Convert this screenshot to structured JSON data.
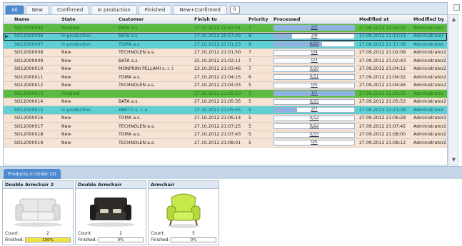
{
  "tabs": [
    {
      "label": "All",
      "active": true
    },
    {
      "label": "New",
      "active": false
    },
    {
      "label": "Confirmed",
      "active": false
    },
    {
      "label": "In production",
      "active": false
    },
    {
      "label": "Finished",
      "active": false
    },
    {
      "label": "New+Confirmed",
      "active": false
    }
  ],
  "tab_count": "0",
  "columns": {
    "name": "Name",
    "state": "State",
    "customer": "Customer",
    "finish_to": "Finish to",
    "priority": "Priority",
    "processed": "Processed",
    "modified_at": "Modified at",
    "modified_by": "Modified by"
  },
  "rows": [
    {
      "name": "SO12000005",
      "state": "Finished",
      "customer": "BATA a.s.",
      "finish_to": "27.10.2012 20:52:01",
      "priority": "7",
      "processed": "2/2",
      "progress": 1.0,
      "modified_at": "27.09.2012 21:15:34",
      "modified_by": "Administrator",
      "kind": "fin",
      "selected": false
    },
    {
      "name": "SO12000006",
      "state": "In production",
      "customer": "BATA a.s.",
      "finish_to": "27.10.2012 20:57:29",
      "priority": "8",
      "processed": "2/9",
      "progress": 0.22,
      "modified_at": "27.09.2012 21:13:19",
      "modified_by": "Administrator",
      "kind": "prod",
      "selected": true
    },
    {
      "name": "SO12000007",
      "state": "In production",
      "customer": "TOMA a.s.",
      "finish_to": "27.10.2012 21:01:23",
      "priority": "8",
      "processed": "6/10",
      "progress": 0.6,
      "modified_at": "27.09.2012 21:17:38",
      "modified_by": "Administrator",
      "kind": "prod",
      "selected": false
    },
    {
      "name": "SO12000008",
      "state": "New",
      "customer": "TECHNOLEN a.s.",
      "finish_to": "27.10.2012 21:01:50",
      "priority": "7",
      "processed": "0/4",
      "progress": 0,
      "modified_at": "27.09.2012 21:02:09",
      "modified_by": "Administrator2",
      "kind": "new",
      "selected": false
    },
    {
      "name": "SO12000009",
      "state": "New",
      "customer": "BATA a.s.",
      "finish_to": "25.10.2012 21:02:11",
      "priority": "7",
      "processed": "0/3",
      "progress": 0,
      "modified_at": "27.09.2012 21:02:43",
      "modified_by": "Administrator2",
      "kind": "new",
      "selected": false
    },
    {
      "name": "SO12000010",
      "state": "New",
      "customer": "MONPRINI PELLAMI s. r. l.",
      "finish_to": "23.10.2012 21:03:46",
      "priority": "7",
      "processed": "0/20",
      "progress": 0,
      "modified_at": "27.09.2012 21:04:12",
      "modified_by": "Administrator2",
      "kind": "new",
      "selected": false
    },
    {
      "name": "SO12000011",
      "state": "New",
      "customer": "TOMA a.s.",
      "finish_to": "27.10.2012 21:04:15",
      "priority": "6",
      "processed": "0/11",
      "progress": 0,
      "modified_at": "27.09.2012 21:04:32",
      "modified_by": "Administrator2",
      "kind": "new",
      "selected": false
    },
    {
      "name": "SO12000012",
      "state": "New",
      "customer": "TECHNOLEN a.s.",
      "finish_to": "27.10.2012 21:04:33",
      "priority": "5",
      "processed": "0/5",
      "progress": 0,
      "modified_at": "27.09.2012 21:04:46",
      "modified_by": "Administrator2",
      "kind": "new",
      "selected": false
    },
    {
      "name": "SO12000013",
      "state": "Finished",
      "customer": "",
      "finish_to": "27.10.2012 21:05:10",
      "priority": "5",
      "processed": "1/1",
      "progress": 1.0,
      "modified_at": "27.09.2012 21:20:22",
      "modified_by": "Administrator",
      "kind": "fin",
      "selected": false
    },
    {
      "name": "SO12000014",
      "state": "New",
      "customer": "BATA a.s.",
      "finish_to": "27.10.2012 21:05:35",
      "priority": "5",
      "processed": "0/15",
      "progress": 0,
      "modified_at": "27.09.2012 21:05:53",
      "modified_by": "Administrator2",
      "kind": "new",
      "selected": false
    },
    {
      "name": "SO12000015",
      "state": "In production",
      "customer": "ANETO s. r. o.",
      "finish_to": "27.10.2012 21:05:55",
      "priority": "5",
      "processed": "2/7",
      "progress": 0.29,
      "modified_at": "27.09.2012 21:21:28",
      "modified_by": "Administrator",
      "kind": "prod",
      "selected": false
    },
    {
      "name": "SO12000016",
      "state": "New",
      "customer": "TOMA a.s.",
      "finish_to": "27.10.2012 21:06:14",
      "priority": "5",
      "processed": "0/12",
      "progress": 0,
      "modified_at": "27.09.2012 21:06:28",
      "modified_by": "Administrator2",
      "kind": "new",
      "selected": false
    },
    {
      "name": "SO12000017",
      "state": "New",
      "customer": "TECHNOLEN a.s.",
      "finish_to": "27.10.2012 21:07:25",
      "priority": "5",
      "processed": "0/22",
      "progress": 0,
      "modified_at": "27.09.2012 21:07:42",
      "modified_by": "Administrator2",
      "kind": "new",
      "selected": false
    },
    {
      "name": "SO12000018",
      "state": "New",
      "customer": "TOMA a.s.",
      "finish_to": "27.10.2012 21:07:43",
      "priority": "5",
      "processed": "0/15",
      "progress": 0,
      "modified_at": "27.09.2012 21:08:00",
      "modified_by": "Administrator2",
      "kind": "new",
      "selected": false
    },
    {
      "name": "SO12000019",
      "state": "New",
      "customer": "TECHNOLEN a.s.",
      "finish_to": "27.10.2012 21:08:01",
      "priority": "5",
      "processed": "0/5",
      "progress": 0,
      "modified_at": "27.09.2012 21:08:12",
      "modified_by": "Administrator2",
      "kind": "new",
      "selected": false
    }
  ],
  "products_panel": {
    "tab_label": "Products in Order (3)",
    "count_label": "Count:",
    "finished_label": "Finished:",
    "cards": [
      {
        "title": "Double Armchair 2",
        "count": "2",
        "finished": "100%",
        "progress": 1.0,
        "image": "white-sofa-image"
      },
      {
        "title": "Double Armchair",
        "count": "2",
        "finished": "0%",
        "progress": 0,
        "image": "dark-sofa-image"
      },
      {
        "title": "Armchair",
        "count": "5",
        "finished": "0%",
        "progress": 0,
        "image": "green-armchair-image"
      }
    ]
  },
  "colors": {
    "new_row": "#f7e3d3",
    "production_row": "#60cfd3",
    "finished_row": "#5bbb40",
    "active_tab": "#4e8ad0",
    "progress_fill": "#8fb3e0",
    "finished_fill": "#f0e63a"
  }
}
